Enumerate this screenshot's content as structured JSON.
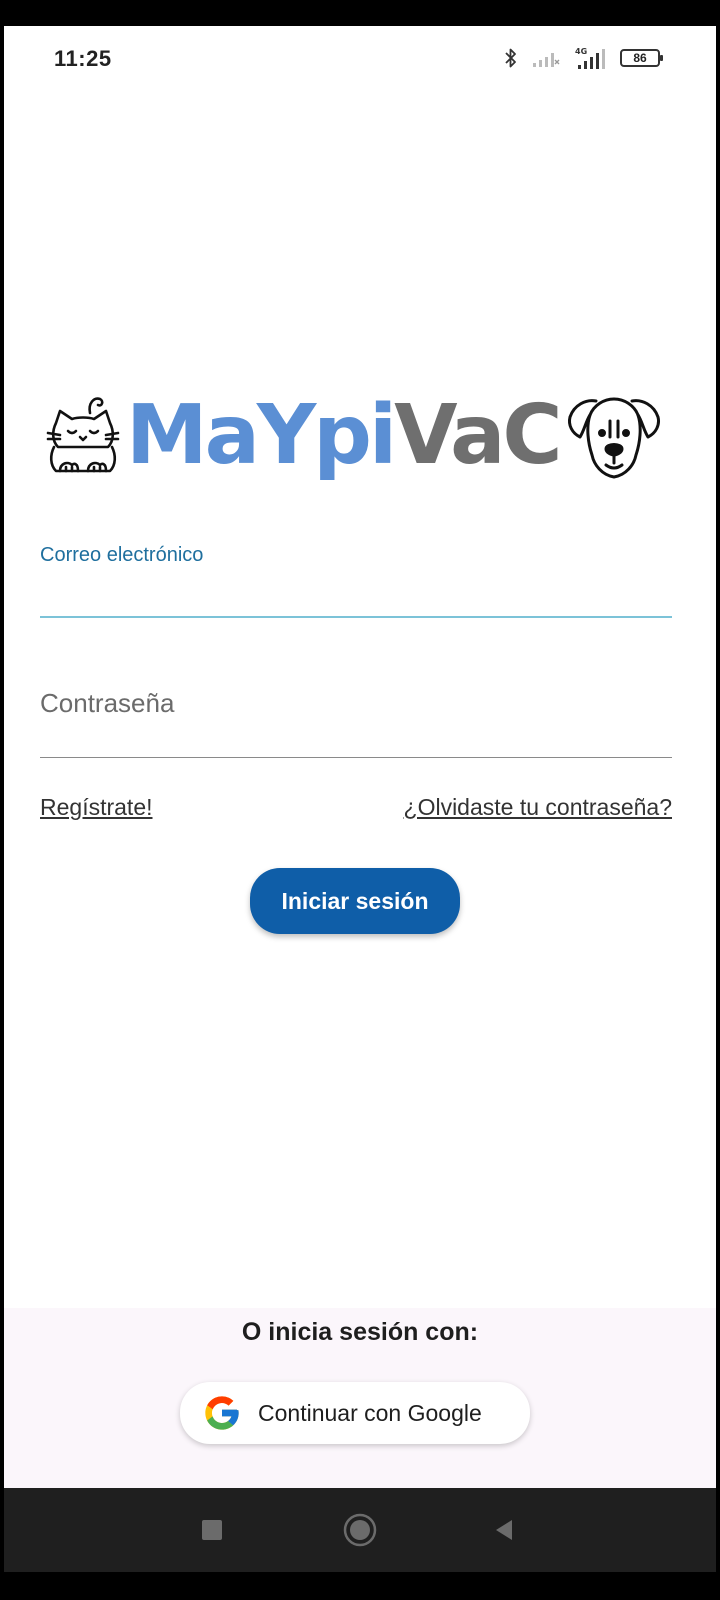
{
  "status_bar": {
    "time": "11:25",
    "network_label": "4G",
    "battery": "86",
    "icons": [
      "bluetooth-icon",
      "signal-icon",
      "signal-4g-icon",
      "battery-icon"
    ]
  },
  "logo": {
    "text_blue": "MaYpi",
    "text_gray": "VaC",
    "icons": [
      "cat-icon",
      "dog-icon"
    ],
    "colors": {
      "blue": "#5b8fd4",
      "gray": "#6f6f6f"
    }
  },
  "form": {
    "email_label": "Correo electrónico",
    "email_value": "",
    "password_placeholder": "Contraseña",
    "register_link": "Regístrate!",
    "forgot_link": "¿Olvidaste tu contraseña?",
    "login_button": "Iniciar sesión",
    "accent_color": "#0f5ea8"
  },
  "alt_login": {
    "heading": "O inicia sesión con:",
    "google_button": "Continuar con Google",
    "google_icon": "google-icon"
  },
  "nav_bar": {
    "buttons": [
      "recent-apps-icon",
      "home-icon",
      "back-icon"
    ]
  }
}
